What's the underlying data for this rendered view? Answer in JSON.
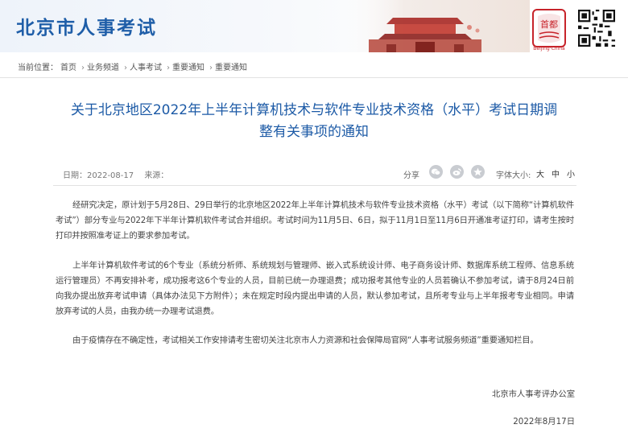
{
  "header": {
    "site_title": "北京市人事考试",
    "logo_text": "首都",
    "logo_sub": "Beijing·China"
  },
  "breadcrumb": {
    "label": "当前位置：",
    "items": [
      "首页",
      "业务频道",
      "人事考试",
      "重要通知",
      "重要通知"
    ],
    "separator": "›"
  },
  "article": {
    "title_line1": "关于北京地区2022年上半年计算机技术与软件专业技术资格（水平）考试日期调",
    "title_line2": "整有关事项的通知",
    "date_label": "日期：",
    "date": "2022-08-17",
    "source_label": "来源：",
    "share_label": "分享",
    "font_size_label": "字体大小:",
    "font_sizes": [
      "大",
      "中",
      "小"
    ],
    "paragraphs": [
      "经研究决定，原计划于5月28日、29日举行的北京地区2022年上半年计算机技术与软件专业技术资格（水平）考试（以下简称“计算机软件考试”）部分专业与2022年下半年计算机软件考试合并组织。考试时间为11月5日、6日，拟于11月1日至11月6日开通准考证打印，请考生按时打印并按照准考证上的要求参加考试。",
      "上半年计算机软件考试的6个专业（系统分析师、系统规划与管理师、嵌入式系统设计师、电子商务设计师、数据库系统工程师、信息系统运行管理员）不再安排补考，成功报考这6个专业的人员，目前已统一办理退费；成功报考其他专业的人员若确认不参加考试，请于8月24日前向我办提出放弃考试申请（具体办法见下方附件）；未在规定时段内提出申请的人员，默认参加考试，且所考专业与上半年报考专业相同。申请放弃考试的人员，由我办统一办理考试退费。",
      "由于疫情存在不确定性，考试相关工作安排请考生密切关注北京市人力资源和社会保障局官网“人事考试服务频道”重要通知栏目。"
    ],
    "signoff_org": "北京市人事考评办公室",
    "signoff_date": "2022年8月17日"
  },
  "colors": {
    "brand_blue": "#1f5ea8",
    "title_blue": "#1c5aa6",
    "logo_red": "#c7242b"
  },
  "icons": [
    "wechat-icon",
    "weibo-icon",
    "qzone-icon",
    "qr-code-icon",
    "capital-logo-icon"
  ]
}
